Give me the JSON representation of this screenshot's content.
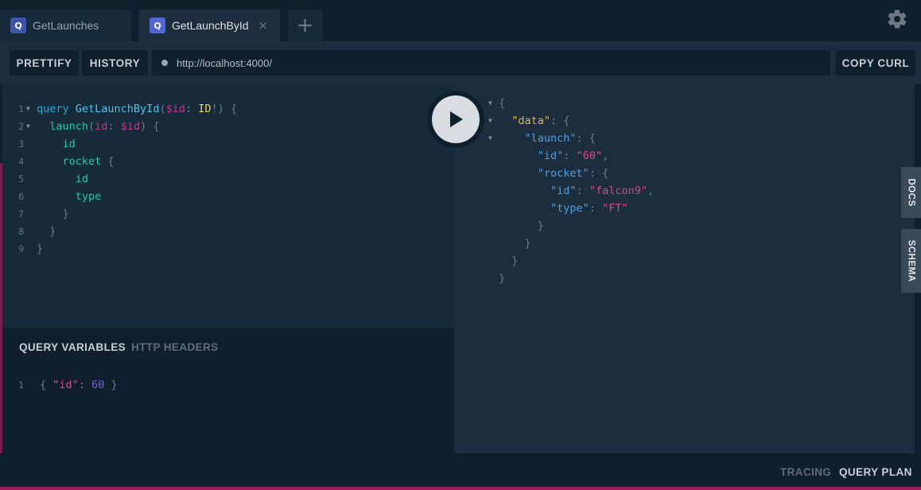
{
  "tabs": [
    {
      "label": "GetLaunches",
      "icon_text": "Q"
    },
    {
      "label": "GetLaunchById",
      "icon_text": "Q",
      "close": "×"
    }
  ],
  "tab_add": "+",
  "toolbar": {
    "prettify": "PRETTIFY",
    "history": "HISTORY",
    "url": "http://localhost:4000/",
    "copy_curl": "COPY CURL"
  },
  "query_lines": [
    {
      "n": "1",
      "fold": "▼",
      "tokens": [
        [
          "kw",
          "query "
        ],
        [
          "def",
          "GetLaunchById"
        ],
        [
          "punc",
          "("
        ],
        [
          "var",
          "$id"
        ],
        [
          "punc",
          ": "
        ],
        [
          "type",
          "ID"
        ],
        [
          "punc",
          "!) {"
        ]
      ]
    },
    {
      "n": "2",
      "fold": "▼",
      "tokens": [
        [
          "field",
          "  launch"
        ],
        [
          "punc",
          "("
        ],
        [
          "var",
          "id"
        ],
        [
          "punc",
          ": "
        ],
        [
          "var",
          "$id"
        ],
        [
          "punc",
          ") {"
        ]
      ]
    },
    {
      "n": "3",
      "fold": "",
      "tokens": [
        [
          "field",
          "    id"
        ]
      ]
    },
    {
      "n": "4",
      "fold": "",
      "tokens": [
        [
          "field",
          "    rocket"
        ],
        [
          "punc",
          " {"
        ]
      ]
    },
    {
      "n": "5",
      "fold": "",
      "tokens": [
        [
          "field",
          "      id"
        ]
      ]
    },
    {
      "n": "6",
      "fold": "",
      "tokens": [
        [
          "field",
          "      type"
        ]
      ]
    },
    {
      "n": "7",
      "fold": "",
      "tokens": [
        [
          "punc",
          "    }"
        ]
      ]
    },
    {
      "n": "8",
      "fold": "",
      "tokens": [
        [
          "punc",
          "  }"
        ]
      ]
    },
    {
      "n": "9",
      "fold": "",
      "tokens": [
        [
          "punc",
          "}"
        ]
      ]
    }
  ],
  "vars_tabs": {
    "query_variables": "QUERY VARIABLES",
    "http_headers": "HTTP HEADERS"
  },
  "variables_line": {
    "n": "1",
    "tokens": [
      [
        "punc",
        "{ "
      ],
      [
        "str",
        "\"id\""
      ],
      [
        "punc",
        ": "
      ],
      [
        "num",
        "60"
      ],
      [
        "punc",
        " }"
      ]
    ]
  },
  "result_lines": [
    {
      "fold": "▼",
      "tokens": [
        [
          "punc",
          "{"
        ]
      ]
    },
    {
      "fold": "▼",
      "tokens": [
        [
          "punc",
          "  "
        ],
        [
          "key-gold",
          "\"data\""
        ],
        [
          "punc",
          ": {"
        ]
      ]
    },
    {
      "fold": "▼",
      "tokens": [
        [
          "punc",
          "    "
        ],
        [
          "key",
          "\"launch\""
        ],
        [
          "punc",
          ": {"
        ]
      ]
    },
    {
      "fold": "",
      "tokens": [
        [
          "punc",
          "      "
        ],
        [
          "key",
          "\"id\""
        ],
        [
          "punc",
          ": "
        ],
        [
          "str",
          "\"60\""
        ],
        [
          "punc",
          ","
        ]
      ]
    },
    {
      "fold": "",
      "tokens": [
        [
          "punc",
          "      "
        ],
        [
          "key",
          "\"rocket\""
        ],
        [
          "punc",
          ": {"
        ]
      ]
    },
    {
      "fold": "",
      "tokens": [
        [
          "punc",
          "        "
        ],
        [
          "key",
          "\"id\""
        ],
        [
          "punc",
          ": "
        ],
        [
          "str",
          "\"falcon9\""
        ],
        [
          "punc",
          ","
        ]
      ]
    },
    {
      "fold": "",
      "tokens": [
        [
          "punc",
          "        "
        ],
        [
          "key",
          "\"type\""
        ],
        [
          "punc",
          ": "
        ],
        [
          "str",
          "\"FT\""
        ]
      ]
    },
    {
      "fold": "",
      "tokens": [
        [
          "punc",
          "      }"
        ]
      ]
    },
    {
      "fold": "",
      "tokens": [
        [
          "punc",
          "    }"
        ]
      ]
    },
    {
      "fold": "",
      "tokens": [
        [
          "punc",
          "  }"
        ]
      ]
    },
    {
      "fold": "",
      "tokens": [
        [
          "punc",
          "}"
        ]
      ]
    }
  ],
  "side_tabs": {
    "docs": "DOCS",
    "schema": "SCHEMA"
  },
  "footer": {
    "tracing": "TRACING",
    "query_plan": "QUERY PLAN"
  },
  "colors": {
    "background": "#0f202d",
    "panel": "#1c2d3d",
    "accent": "#5165d6"
  },
  "icons": {
    "gear": "gear-icon",
    "play": "play-icon",
    "query": "query-icon"
  }
}
